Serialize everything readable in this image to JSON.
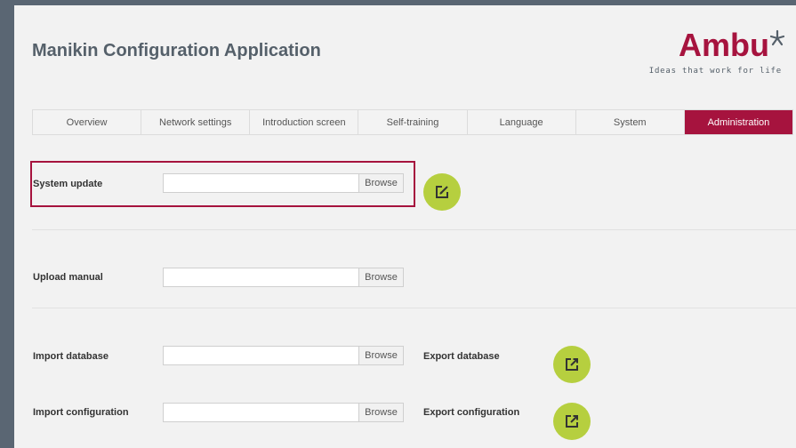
{
  "app": {
    "title": "Manikin Configuration Application"
  },
  "logo": {
    "word": "Ambu",
    "tagline": "Ideas that work for life"
  },
  "tabs": [
    {
      "label": "Overview",
      "active": false
    },
    {
      "label": "Network settings",
      "active": false
    },
    {
      "label": "Introduction screen",
      "active": false
    },
    {
      "label": "Self-training",
      "active": false
    },
    {
      "label": "Language",
      "active": false
    },
    {
      "label": "System",
      "active": false
    },
    {
      "label": "Administration",
      "active": true
    }
  ],
  "form": {
    "system_update": {
      "label": "System update",
      "value": "",
      "browse": "Browse"
    },
    "upload_manual": {
      "label": "Upload manual",
      "value": "",
      "browse": "Browse"
    },
    "import_database": {
      "label": "Import database",
      "value": "",
      "browse": "Browse"
    },
    "import_configuration": {
      "label": "Import configuration",
      "value": "",
      "browse": "Browse"
    },
    "export_database": {
      "label": "Export database"
    },
    "export_configuration": {
      "label": "Export configuration"
    }
  },
  "colors": {
    "accent": "#a6133e",
    "action": "#b6cf3f",
    "title": "#55606a"
  }
}
